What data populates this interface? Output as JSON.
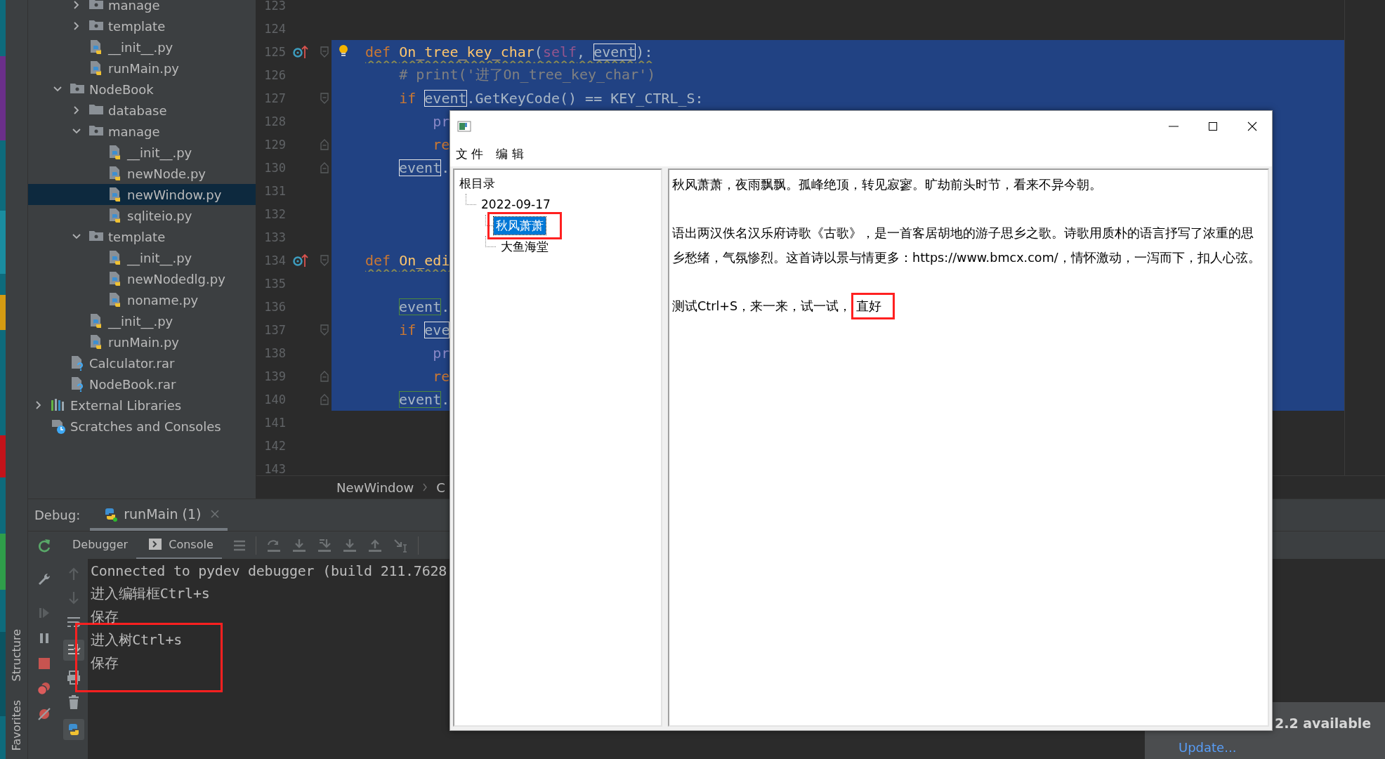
{
  "tool_strip": {
    "labels": [
      "Structure",
      "Favorites"
    ]
  },
  "project_tree": [
    {
      "kind": "group",
      "children": [
        {
          "kind": "group",
          "children": [
            {
              "label": "manage",
              "kind": "package",
              "expanded": false,
              "selected": false
            },
            {
              "label": "template",
              "kind": "package",
              "expanded": false,
              "selected": false
            },
            {
              "label": "__init__.py",
              "kind": "python",
              "selected": false
            },
            {
              "label": "runMain.py",
              "kind": "python",
              "selected": false
            }
          ]
        },
        {
          "label": "NodeBook",
          "kind": "package",
          "expanded": true,
          "selected": false,
          "children": [
            {
              "label": "database",
              "kind": "folder",
              "expanded": false,
              "selected": false
            },
            {
              "label": "manage",
              "kind": "package",
              "expanded": true,
              "selected": false,
              "children": [
                {
                  "label": "__init__.py",
                  "kind": "python",
                  "selected": false
                },
                {
                  "label": "newNode.py",
                  "kind": "python",
                  "selected": false
                },
                {
                  "label": "newWindow.py",
                  "kind": "python",
                  "selected": true
                },
                {
                  "label": "sqliteio.py",
                  "kind": "python",
                  "selected": false
                }
              ]
            },
            {
              "label": "template",
              "kind": "package",
              "expanded": true,
              "selected": false,
              "children": [
                {
                  "label": "__init__.py",
                  "kind": "python",
                  "selected": false
                },
                {
                  "label": "newNodedlg.py",
                  "kind": "python",
                  "selected": false
                },
                {
                  "label": "noname.py",
                  "kind": "python",
                  "selected": false
                }
              ]
            },
            {
              "label": "__init__.py",
              "kind": "python",
              "selected": false
            },
            {
              "label": "runMain.py",
              "kind": "python",
              "selected": false
            }
          ]
        },
        {
          "label": "Calculator.rar",
          "kind": "archive",
          "selected": false
        },
        {
          "label": "NodeBook.rar",
          "kind": "archive",
          "selected": false
        }
      ]
    },
    {
      "label": "External Libraries",
      "kind": "libraries",
      "expanded": false,
      "selected": false
    },
    {
      "label": "Scratches and Consoles",
      "kind": "scratches",
      "selected": false
    }
  ],
  "editor": {
    "lines": [
      {
        "number": "123",
        "selected": false
      },
      {
        "number": "124",
        "selected": false
      },
      {
        "number": "125",
        "selected": true,
        "override_marker": true,
        "fold_start": true,
        "bulb": true,
        "warning": true,
        "tokens": [
          {
            "text": "def ",
            "kind": "keyword"
          },
          {
            "text": "On_tree_key_char",
            "kind": "function"
          },
          {
            "text": "(",
            "kind": "plain"
          },
          {
            "text": "self",
            "kind": "self"
          },
          {
            "text": ", ",
            "kind": "plain"
          },
          {
            "text": "event",
            "kind": "ref"
          },
          {
            "text": "):",
            "kind": "plain"
          }
        ]
      },
      {
        "number": "126",
        "selected": true,
        "tokens": [
          {
            "text": "    # print('进了On_tree_key_char')",
            "kind": "comment"
          }
        ]
      },
      {
        "number": "127",
        "selected": true,
        "fold_start": true,
        "tokens": [
          {
            "text": "    if ",
            "kind": "keyword"
          },
          {
            "text": "event",
            "kind": "ref"
          },
          {
            "text": ".GetKeyCode() == KEY_CTRL_S:",
            "kind": "plain"
          }
        ]
      },
      {
        "number": "128",
        "selected": true,
        "tokens": [
          {
            "text": "        pr",
            "kind": "builtin"
          }
        ]
      },
      {
        "number": "129",
        "selected": true,
        "fold_end": true,
        "tokens": [
          {
            "text": "        re",
            "kind": "keyword"
          }
        ]
      },
      {
        "number": "130",
        "selected": true,
        "fold_end": true,
        "nested": true,
        "tokens": [
          {
            "text": "event",
            "kind": "ref"
          },
          {
            "text": ".",
            "kind": "plain"
          }
        ]
      },
      {
        "number": "131",
        "selected": true
      },
      {
        "number": "132",
        "selected": true
      },
      {
        "number": "133",
        "selected": true
      },
      {
        "number": "134",
        "selected": true,
        "override_marker": true,
        "fold_start": true,
        "warning": true,
        "tokens": [
          {
            "text": "def ",
            "kind": "keyword"
          },
          {
            "text": "On_edi",
            "kind": "function"
          }
        ]
      },
      {
        "number": "135",
        "selected": true
      },
      {
        "number": "136",
        "selected": true,
        "nested": true,
        "tokens": [
          {
            "text": "event",
            "kind": "write"
          },
          {
            "text": ".",
            "kind": "plain"
          }
        ]
      },
      {
        "number": "137",
        "selected": true,
        "fold_start": true,
        "tokens": [
          {
            "text": "    if ",
            "kind": "keyword"
          },
          {
            "text": "eve",
            "kind": "ref"
          }
        ]
      },
      {
        "number": "138",
        "selected": true,
        "tokens": [
          {
            "text": "        pr",
            "kind": "builtin"
          }
        ]
      },
      {
        "number": "139",
        "selected": true,
        "fold_end": true,
        "tokens": [
          {
            "text": "        re",
            "kind": "keyword"
          }
        ]
      },
      {
        "number": "140",
        "selected": true,
        "fold_end": true,
        "nested": true,
        "tokens": [
          {
            "text": "event",
            "kind": "write"
          },
          {
            "text": ".",
            "kind": "plain"
          }
        ]
      },
      {
        "number": "141",
        "selected": false
      },
      {
        "number": "142",
        "selected": false
      },
      {
        "number": "143",
        "selected": false
      }
    ],
    "breadcrumb": [
      "NewWindow",
      "C"
    ]
  },
  "debug": {
    "title": "Debug:",
    "session_tab": {
      "label": "runMain (1)",
      "selected": true
    },
    "tabs": [
      {
        "label": "Debugger",
        "selected": false
      },
      {
        "label": "Console",
        "selected": true
      }
    ],
    "console": [
      {
        "text": "Connected to pydev debugger (build 211.7628",
        "boxed": false
      },
      {
        "text": "进入编辑框Ctrl+s",
        "boxed": false
      },
      {
        "text": "保存",
        "boxed": false
      },
      {
        "text": "进入树Ctrl+s",
        "boxed": true
      },
      {
        "text": "保存",
        "boxed": true
      }
    ]
  },
  "dialog": {
    "menu": [
      "文 件",
      "编 辑"
    ],
    "tree": [
      {
        "label": "根目录",
        "selected": false,
        "boxed": false,
        "children": [
          {
            "label": "2022-09-17",
            "selected": false,
            "boxed": false,
            "children": [
              {
                "label": "秋风萧萧",
                "selected": true,
                "boxed": true
              },
              {
                "label": "大鱼海堂",
                "selected": false,
                "boxed": false
              }
            ]
          }
        ]
      }
    ],
    "paragraphs": [
      [
        {
          "text": "秋风萧萧，夜雨飘飘。孤峰绝顶，转见寂寥。旷劫前头时节，看来不异今朝。",
          "boxed": false
        }
      ],
      [
        {
          "text": "语出两汉佚名汉乐府诗歌《古歌》，是一首客居胡地的游子思乡之歌。诗歌用质朴的语言抒写了浓重的思乡愁绪，气氛惨烈。这首诗以景与情更多：https://www.bmcx.com/，情怀激动，一泻而下，扣人心弦。",
          "boxed": false
        }
      ],
      [
        {
          "text": "测试Ctrl+S，来一来，试一试，",
          "boxed": false
        },
        {
          "text": "直好",
          "boxed": true
        }
      ]
    ]
  },
  "notification": {
    "message": "2.2 available",
    "link": "Update..."
  }
}
